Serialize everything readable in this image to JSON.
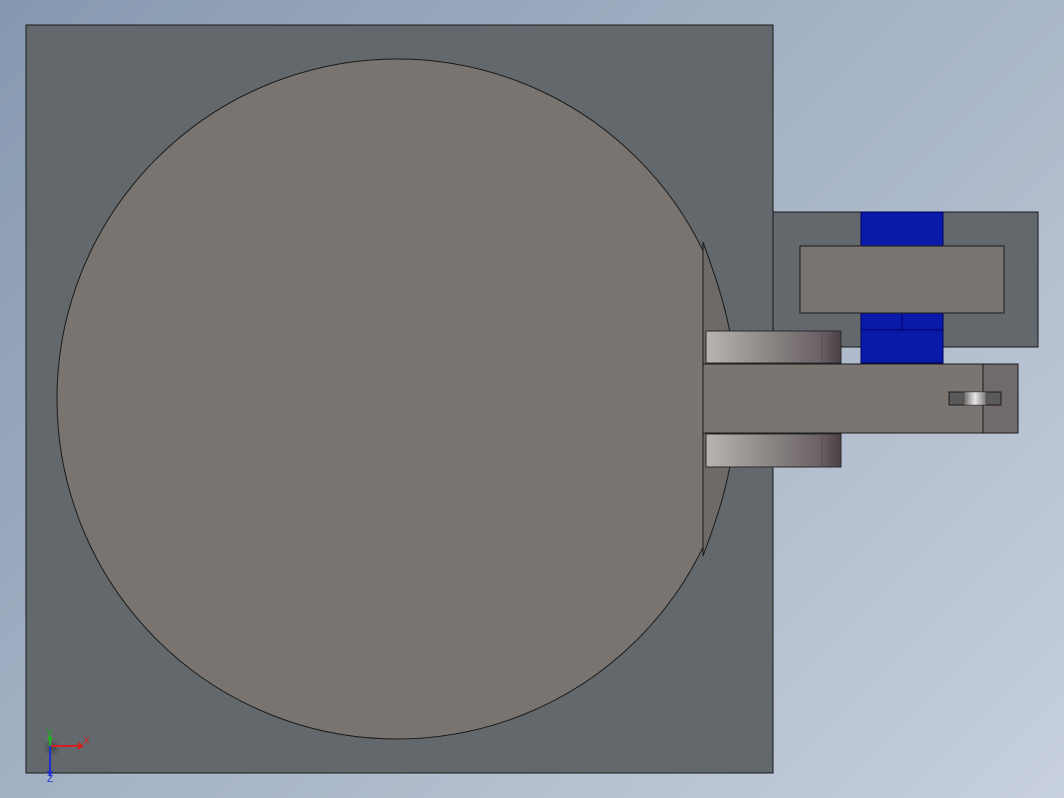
{
  "viewport": {
    "background_top": "#8698b0",
    "background_bottom": "#c7d0dc"
  },
  "model": {
    "base_plate_color": "#62686c",
    "disc_color": "#79746f",
    "arm_color": "#7a7570",
    "bracket_color": "#62686c",
    "blue_block_color": "#0a1aa8",
    "edge_color": "#1a1a1a"
  },
  "triad": {
    "x_label": "X",
    "y_label": "Y",
    "z_label": "Z",
    "x_color": "#d42020",
    "y_color": "#20b020",
    "z_color": "#2030d0"
  }
}
